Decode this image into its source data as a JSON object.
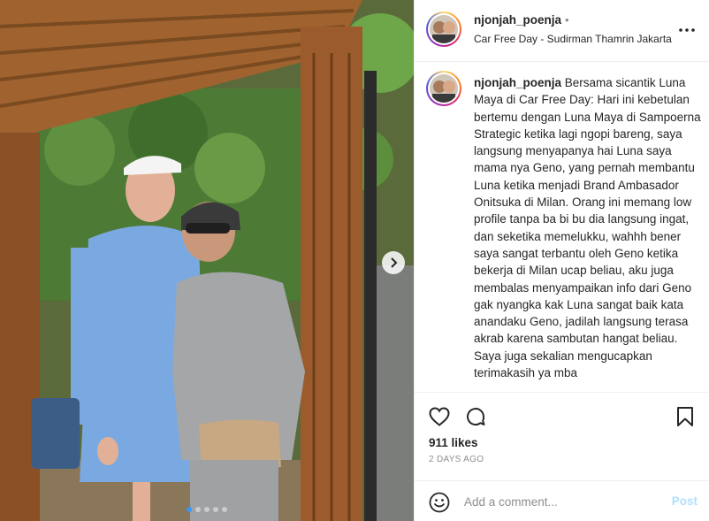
{
  "post": {
    "username": "njonjah_poenja",
    "header_separator": "•",
    "location": "Car Free Day - Sudirman Thamrin Jakarta",
    "caption_text": "Bersama sicantik Luna Maya di Car Free Day: Hari ini kebetulan bertemu dengan Luna Maya di Sampoerna Strategic ketika lagi ngopi bareng, saya langsung menyapanya hai Luna saya mama nya Geno, yang pernah membantu Luna ketika menjadi Brand Ambasador Onitsuka di Milan. Orang ini memang low profile tanpa ba bi bu dia langsung ingat, dan seketika memelukku, wahhh bener saya sangat terbantu oleh Geno ketika bekerja di Milan ucap beliau, aku juga membalas menyampaikan info dari Geno gak nyangka kak Luna sangat baik kata anandaku Geno, jadilah langsung terasa akrab karena sambutan hangat beliau. Saya juga sekalian mengucapkan terimakasih ya mba",
    "likes": "911 likes",
    "timestamp": "2 DAYS AGO"
  },
  "carousel": {
    "slide_count": 5,
    "active_index": 0
  },
  "icons": {
    "more": "more-horizontal-icon",
    "like": "heart-icon",
    "comment": "comment-bubble-icon",
    "save": "bookmark-icon",
    "emoji": "smiley-icon",
    "next": "chevron-right-icon"
  },
  "comment_box": {
    "placeholder": "Add a comment...",
    "post_label": "Post"
  },
  "colors": {
    "post_disabled": "#b2dffc",
    "active_dot": "#3897f0",
    "secondary_text": "#8e8e8e"
  }
}
